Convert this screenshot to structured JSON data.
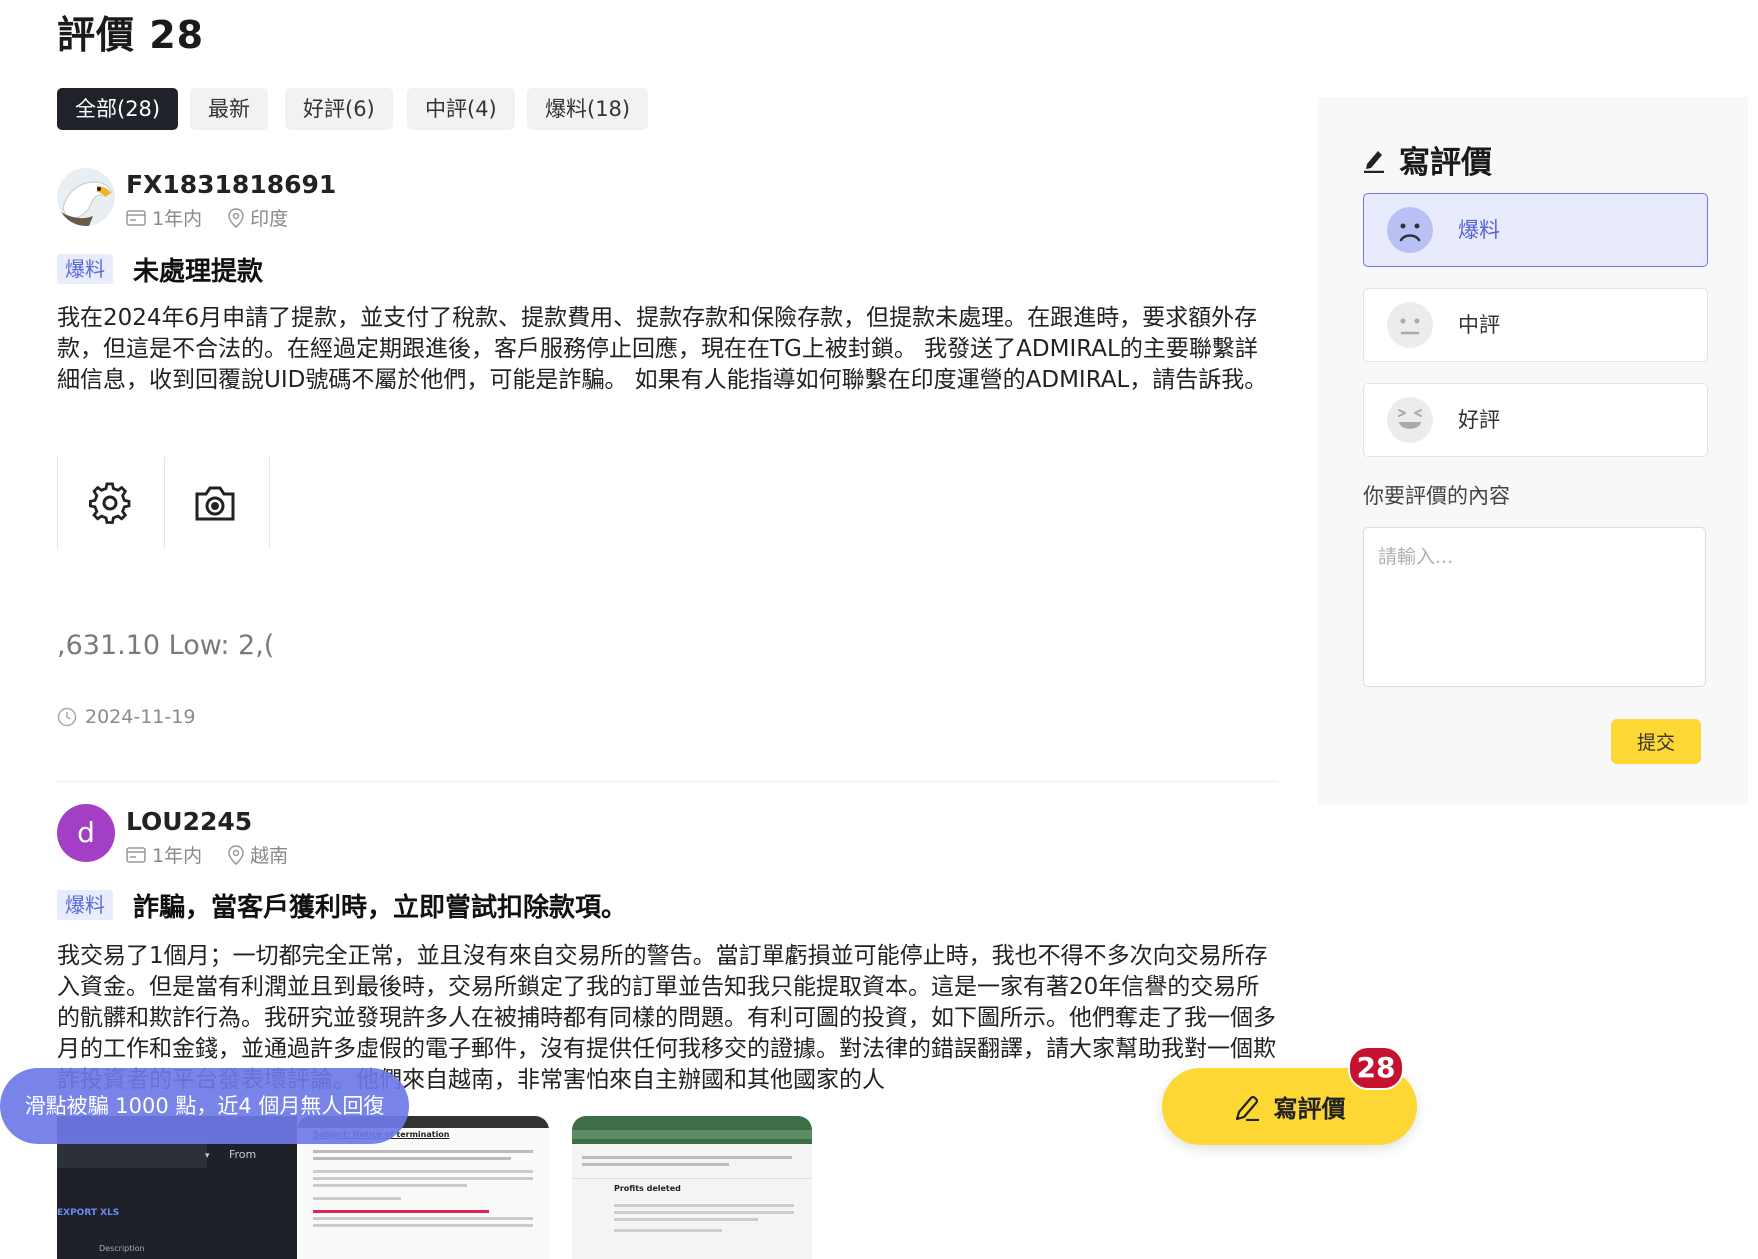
{
  "header": {
    "title": "評價 28"
  },
  "tabs": [
    {
      "label": "全部(28)",
      "active": true
    },
    {
      "label": "最新",
      "active": false
    },
    {
      "label": "好評(6)",
      "active": false
    },
    {
      "label": "中評(4)",
      "active": false
    },
    {
      "label": "爆料(18)",
      "active": false
    }
  ],
  "reviews": [
    {
      "username": "FX1831818691",
      "time": "1年内",
      "location": "印度",
      "tag": "爆料",
      "title": "未處理提款",
      "body": "我在2024年6月申請了提款，並支付了稅款、提款費用、提款存款和保險存款，但提款未處理。在跟進時，要求額外存款，但這是不合法的。在經過定期跟進後，客戶服務停止回應，現在在TG上被封鎖。 我發送了ADMIRAL的主要聯繫詳細信息，收到回覆說UID號碼不屬於他們，可能是詐騙。 如果有人能指導如何聯繫在印度運營的ADMIRAL，請告訴我。",
      "image_fragment": ",631.10   Low: 2,(",
      "date": "2024-11-19"
    },
    {
      "username": "LOU2245",
      "avatar_letter": "d",
      "time": "1年内",
      "location": "越南",
      "tag": "爆料",
      "title": "詐騙，當客戶獲利時，立即嘗試扣除款項。",
      "body": "我交易了1個月；一切都完全正常，並且沒有來自交易所的警告。當訂單虧損並可能停止時，我也不得不多次向交易所存入資金。但是當有利潤並且到最後時，交易所鎖定了我的訂單並告知我只能提取資本。這是一家有著20年信譽的交易所的骯髒和欺詐行為。我研究並發現許多人在被捕時都有同樣的問題。有利可圖的投資，如下圖所示。他們奪走了我一個多月的工作和金錢，並通過許多虛假的電子郵件，沒有提供任何我移交的證據。對法律的錯誤翻譯，請大家幫助我對一個欺詐投資者的平台發表壞評論。他們來自越南，非常害怕來自主辦國和其他國家的人",
      "screenshots": {
        "s1_select": "From",
        "s1_link": "EXPORT XLS",
        "s1_foot": "Description",
        "s2_heading": "Subject: Notice of termination",
        "s3_heading": "Profits deleted"
      }
    }
  ],
  "sidebar": {
    "title": "寫評價",
    "options": [
      {
        "label": "爆料",
        "selected": true
      },
      {
        "label": "中評",
        "selected": false
      },
      {
        "label": "好評",
        "selected": false
      }
    ],
    "content_label": "你要評價的內容",
    "placeholder": "請輸入...",
    "submit_label": "提交"
  },
  "floating": {
    "banner": "滑點被騙 1000 點，近4 個月無人回復",
    "fab_label": "寫評價",
    "fab_badge": "28"
  },
  "colors": {
    "accent_yellow": "#fdd835",
    "tag_blue": "#5a6ad8",
    "active_tab": "#1f2329",
    "badge_red": "#c4122f"
  }
}
